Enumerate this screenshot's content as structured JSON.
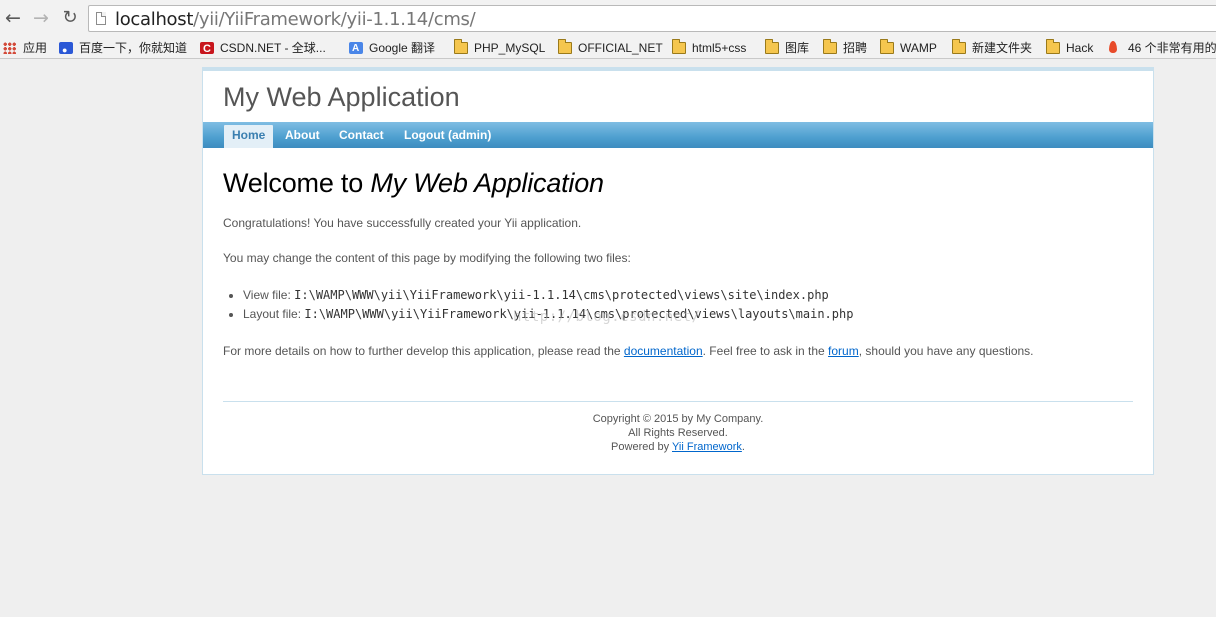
{
  "browser": {
    "url_host": "localhost",
    "url_path": "/yii/YiiFramework/yii-1.1.14/cms/"
  },
  "bookmarks": [
    {
      "label": "应用",
      "icon": "apps-grid-icon"
    },
    {
      "label": "百度一下，你就知道",
      "icon": "baidu-icon"
    },
    {
      "label": "CSDN.NET - 全球...",
      "icon": "csdn-icon"
    },
    {
      "label": "Google 翻译",
      "icon": "google-translate-icon"
    },
    {
      "label": "PHP_MySQL",
      "icon": "folder-icon"
    },
    {
      "label": "OFFICIAL_NET",
      "icon": "folder-icon"
    },
    {
      "label": "html5+css",
      "icon": "folder-icon"
    },
    {
      "label": "图库",
      "icon": "folder-icon"
    },
    {
      "label": "招聘",
      "icon": "folder-icon"
    },
    {
      "label": "WAMP",
      "icon": "folder-icon"
    },
    {
      "label": "新建文件夹",
      "icon": "folder-icon"
    },
    {
      "label": "Hack",
      "icon": "folder-icon"
    },
    {
      "label": "46 个非常有用的",
      "icon": "flame-icon"
    }
  ],
  "site": {
    "logo": "My Web Application",
    "menu": {
      "home": "Home",
      "about": "About",
      "contact": "Contact",
      "logout": "Logout (admin)"
    },
    "heading_prefix": "Welcome to ",
    "heading_app": "My Web Application",
    "congrats": "Congratulations! You have successfully created your Yii application.",
    "change_text": "You may change the content of this page by modifying the following two files:",
    "files": [
      {
        "label": "View file: ",
        "path": "I:\\WAMP\\WWW\\yii\\YiiFramework\\yii-1.1.14\\cms\\protected\\views\\site\\index.php"
      },
      {
        "label": "Layout file: ",
        "path": "I:\\WAMP\\WWW\\yii\\YiiFramework\\yii-1.1.14\\cms\\protected\\views\\layouts\\main.php"
      }
    ],
    "details_pre": "For more details on how to further develop this application, please read the ",
    "documentation_link": "documentation",
    "details_mid": ". Feel free to ask in the ",
    "forum_link": "forum",
    "details_post": ", should you have any questions.",
    "footer": {
      "copyright": "Copyright © 2015 by My Company.",
      "rights": "All Rights Reserved.",
      "powered_pre": "Powered by ",
      "powered_link": "Yii Framework",
      "powered_post": "."
    },
    "watermark": "http://blog.csdn.net/"
  }
}
